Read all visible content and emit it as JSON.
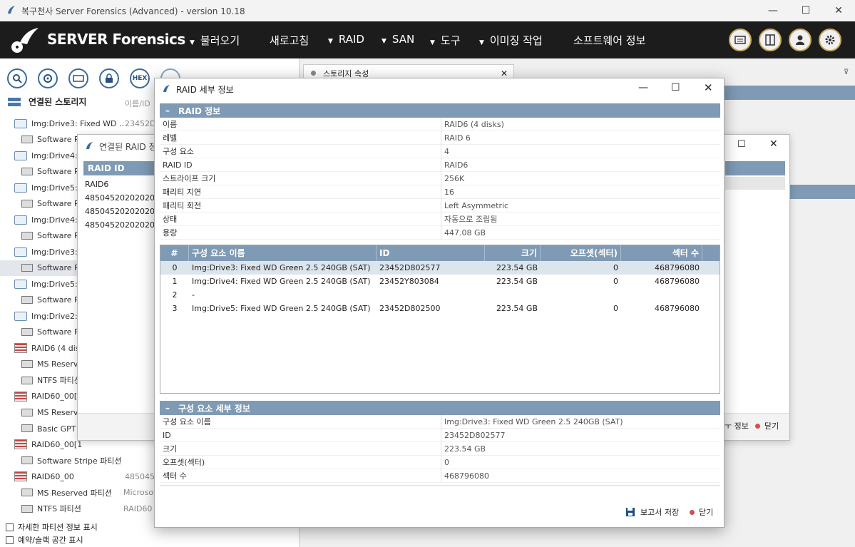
{
  "window": {
    "title": "복구천사 Server Forensics (Advanced) - version 10.18",
    "min": "—",
    "max": "☐",
    "close": "✕"
  },
  "nav": {
    "brand": "SERVER Forensics",
    "items": [
      {
        "label": "불러오기",
        "arrow": "▼"
      },
      {
        "label": "새로고침",
        "arrow": ""
      },
      {
        "label": "RAID",
        "arrow": "▼"
      },
      {
        "label": "SAN",
        "arrow": "▼"
      },
      {
        "label": "도구",
        "arrow": "▼"
      },
      {
        "label": "이미징 작업",
        "arrow": "▼"
      },
      {
        "label": "소프트웨어 정보",
        "arrow": ""
      }
    ]
  },
  "toolbar": {
    "hex": "HEX"
  },
  "left": {
    "header": "연결된 스토리지",
    "col": "이름/ID",
    "tree": [
      {
        "label": "Img:Drive3: Fixed WD ...",
        "id": "23452D8",
        "type": "drive",
        "indent": 0
      },
      {
        "label": "Software RA",
        "id": "",
        "type": "part",
        "indent": 1
      },
      {
        "label": "Img:Drive4:",
        "id": "",
        "type": "drive",
        "indent": 0
      },
      {
        "label": "Software RA",
        "id": "",
        "type": "part",
        "indent": 1
      },
      {
        "label": "Img:Drive5:",
        "id": "",
        "type": "drive",
        "indent": 0
      },
      {
        "label": "Software RA",
        "id": "",
        "type": "part",
        "indent": 1
      },
      {
        "label": "Img:Drive4:",
        "id": "",
        "type": "drive",
        "indent": 0
      },
      {
        "label": "Software RA",
        "id": "",
        "type": "part",
        "indent": 1
      },
      {
        "label": "Img:Drive3:",
        "id": "",
        "type": "drive",
        "indent": 0
      },
      {
        "label": "Software RA",
        "id": "",
        "type": "part",
        "indent": 1,
        "selected": true
      },
      {
        "label": "Img:Drive5:",
        "id": "",
        "type": "drive",
        "indent": 0
      },
      {
        "label": "Software RA",
        "id": "",
        "type": "part",
        "indent": 1
      },
      {
        "label": "Img:Drive2:",
        "id": "",
        "type": "drive",
        "indent": 0
      },
      {
        "label": "Software RA",
        "id": "",
        "type": "part",
        "indent": 1
      },
      {
        "label": "RAID6 (4 dis",
        "id": "",
        "type": "raid",
        "indent": 0
      },
      {
        "label": "MS Reserve",
        "id": "",
        "type": "part",
        "indent": 1
      },
      {
        "label": "NTFS 파티션",
        "id": "",
        "type": "part",
        "indent": 1
      },
      {
        "label": "RAID60_00[0",
        "id": "",
        "type": "raid",
        "indent": 0
      },
      {
        "label": "MS Reserve",
        "id": "",
        "type": "part",
        "indent": 1
      },
      {
        "label": "Basic GPT 파",
        "id": "",
        "type": "part",
        "indent": 1
      },
      {
        "label": "RAID60_00[1",
        "id": "",
        "type": "raid",
        "indent": 0
      },
      {
        "label": "Software Stripe 파티션",
        "id": "",
        "type": "part",
        "indent": 1
      },
      {
        "label": "RAID60_00",
        "id": "48504520",
        "type": "raid",
        "indent": 0
      },
      {
        "label": "MS Reserved 파티션",
        "id": "Microsof",
        "type": "part",
        "indent": 1
      },
      {
        "label": "NTFS 파티션",
        "id": "RAID60",
        "type": "part",
        "indent": 1
      }
    ],
    "check1": "자세한 파티션 정보 표시",
    "check2": "예약/슬랙 공간 표시"
  },
  "tab": {
    "label": "스토리지 속성"
  },
  "bgwin": {
    "title": "연결된 RAID 정",
    "col": "RAID ID",
    "rows": [
      "RAID6",
      "4850452020202020",
      "4850452020202020",
      "4850452020202020"
    ],
    "report": "ㅜ 정보",
    "close": "닫기"
  },
  "dialog": {
    "title": "RAID 세부 정보",
    "raid_section": "RAID 정보",
    "raid_info": [
      {
        "k": "이름",
        "v": "RAID6 (4 disks)"
      },
      {
        "k": "레벨",
        "v": "RAID 6"
      },
      {
        "k": "구성 요소",
        "v": "4"
      },
      {
        "k": "RAID ID",
        "v": "RAID6"
      },
      {
        "k": "스트라이프 크기",
        "v": "256K"
      },
      {
        "k": "패리티 지연",
        "v": "16"
      },
      {
        "k": "패리티 회전",
        "v": "Left Asymmetric"
      },
      {
        "k": "상태",
        "v": "자동으로 조립됨"
      },
      {
        "k": "용량",
        "v": "447.08 GB"
      }
    ],
    "table_headers": [
      "#",
      "구성 요소 이름",
      "ID",
      "크기",
      "오프셋(섹터)",
      "섹터 수"
    ],
    "table_rows": [
      [
        "0",
        "Img:Drive3: Fixed WD Green 2.5 240GB (SAT)",
        "23452D802577",
        "223.54 GB",
        "0",
        "468796080"
      ],
      [
        "1",
        "Img:Drive4: Fixed WD Green 2.5 240GB (SAT)",
        "23452Y803084",
        "223.54 GB",
        "0",
        "468796080"
      ],
      [
        "2",
        "-",
        "",
        "",
        "",
        ""
      ],
      [
        "3",
        "Img:Drive5: Fixed WD Green 2.5 240GB (SAT)",
        "23452D802500",
        "223.54 GB",
        "0",
        "468796080"
      ]
    ],
    "detail_section": "구성 요소 세부 정보",
    "detail_info": [
      {
        "k": "구성 요소 이름",
        "v": "Img:Drive3: Fixed WD Green 2.5 240GB (SAT)"
      },
      {
        "k": "ID",
        "v": "23452D802577"
      },
      {
        "k": "크기",
        "v": "223.54 GB"
      },
      {
        "k": "오프셋(섹터)",
        "v": "0"
      },
      {
        "k": "섹터 수",
        "v": "468796080"
      }
    ],
    "save_report": "보고서 저장",
    "close": "닫기",
    "collapse": "–"
  }
}
